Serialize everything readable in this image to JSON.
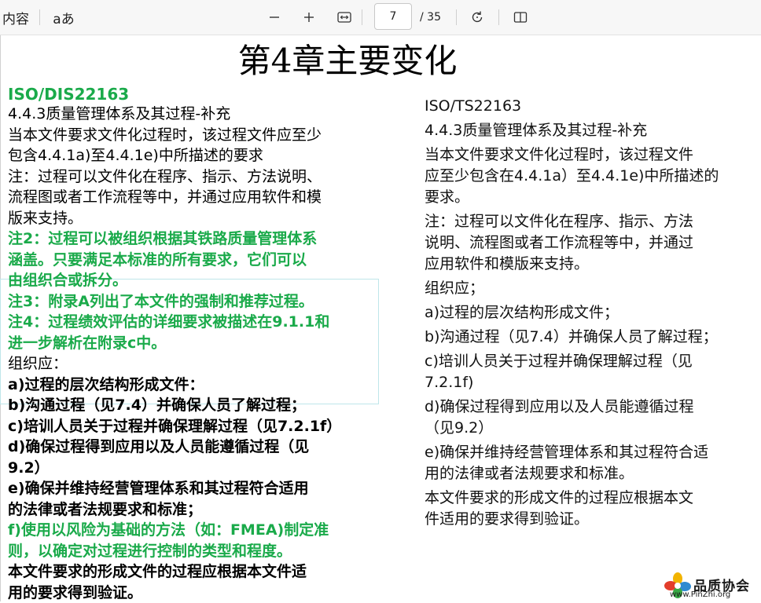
{
  "toolbar": {
    "contents_label": "内容",
    "read_aloud_label": "aあ",
    "page_current": "7",
    "page_total": "/ 35"
  },
  "document": {
    "title": "第4章主要变化",
    "left": {
      "header": "ISO/DIS22163",
      "lines": [
        {
          "text": "4.4.3质量管理体系及其过程-补充",
          "style": "normal"
        },
        {
          "text": "当本文件要求文件化过程时，该过程文件应至少\n包含4.4.1a)至4.4.1e)中所描述的要求",
          "style": "normal"
        },
        {
          "text": "注：过程可以文件化在程序、指示、方法说明、\n流程图或者工作流程等中，并通过应用软件和模\n版来支持。",
          "style": "normal"
        },
        {
          "text": "注2：过程可以被组织根据其铁路质量管理体系\n涵盖。只要满足本标准的所有要求，它们可以\n由组织合或拆分。",
          "style": "green"
        },
        {
          "text": "注3：附录A列出了本文件的强制和推荐过程。",
          "style": "green"
        },
        {
          "text": "注4：过程绩效评估的详细要求被描述在9.1.1和\n进一步解析在附录c中。",
          "style": "green"
        },
        {
          "text": "组织应：",
          "style": "normal"
        },
        {
          "text": "a)过程的层次结构形成文件：",
          "style": "bold"
        },
        {
          "text": "b)沟通过程（见7.4）并确保人员了解过程；",
          "style": "bold"
        },
        {
          "text": "c)培训人员关于过程并确保理解过程（见7.2.1f）",
          "style": "bold"
        },
        {
          "text": "d)确保过程得到应用以及人员能遵循过程（见\n9.2）",
          "style": "bold"
        },
        {
          "text": "e)确保并维持经营管理体系和其过程符合适用\n的法律或者法规要求和标准；",
          "style": "bold"
        },
        {
          "text": "f)使用以风险为基础的方法（如：FMEA)制定准\n则，以确定对过程进行控制的类型和程度。",
          "style": "green"
        },
        {
          "text": "本文件要求的形成文件的过程应根据本文件适\n用的要求得到验证。",
          "style": "bold"
        }
      ]
    },
    "right": {
      "header": "ISO/TS22163",
      "lines": [
        "4.4.3质量管理体系及其过程-补充",
        "当本文件要求文件化过程时，该过程文件\n应至少包含在4.4.1a）至4.4.1e)中所描述的\n要求。",
        "注：过程可以文件化在程序、指示、方法\n说明、流程图或者工作流程等中，并通过\n应用软件和模版来支持。",
        "组织应；",
        "a)过程的层次结构形成文件；",
        "b)沟通过程（见7.4）并确保人员了解过程；",
        "c)培训人员关于过程并确保理解过程（见\n7.2.1f)",
        "d)确保过程得到应用以及人员能遵循过程\n（见9.2）",
        "e)确保并维持经营管理体系和其过程符合适\n用的法律或者法规要求和标准。",
        "本文件要求的形成文件的过程应根据本文\n件适用的要求得到验证。"
      ]
    },
    "watermark": {
      "name": "品质协会",
      "url": "www.PinZhi.org"
    }
  }
}
